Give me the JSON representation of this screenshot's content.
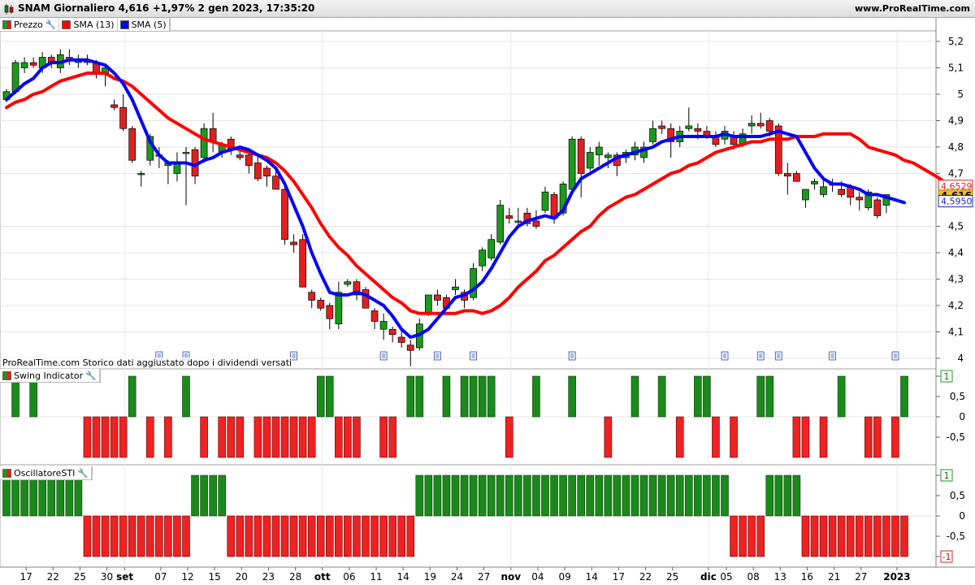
{
  "window": {
    "title": "SNAM Giornaliero 4,616 +1,97% 2 gen 2023, 17:35:20",
    "site": "www.ProRealTime.com"
  },
  "legend_main": [
    {
      "label": "Prezzo",
      "color": "#1a9a1a",
      "color2": "#e02020",
      "icon": "wrench-icon"
    },
    {
      "label": "SMA (13)",
      "color": "#ff0000"
    },
    {
      "label": "SMA (5)",
      "color": "#0000ff"
    }
  ],
  "legend_swing": {
    "label": "Swing Indicator",
    "icon": "wrench-icon"
  },
  "legend_osc": {
    "label": "OscillatoreSTI",
    "icon": "wrench-icon"
  },
  "note": "ProRealTime.com Storico dati aggiustato dopo i dividendi versati",
  "chart_data": [
    {
      "type": "candlestick",
      "title": "SNAM Giornaliero",
      "ylim": [
        3.96,
        5.24
      ],
      "yticks": [
        {
          "v": 5.2,
          "label": "5,2"
        },
        {
          "v": 5.1,
          "label": "5,1"
        },
        {
          "v": 5.0,
          "label": "5"
        },
        {
          "v": 4.9,
          "label": "4,9"
        },
        {
          "v": 4.8,
          "label": "4,8"
        },
        {
          "v": 4.7,
          "label": "4,7"
        },
        {
          "v": 4.5,
          "label": "4,5"
        },
        {
          "v": 4.4,
          "label": "4,4"
        },
        {
          "v": 4.3,
          "label": "4,3"
        },
        {
          "v": 4.2,
          "label": "4,2"
        },
        {
          "v": 4.1,
          "label": "4,1"
        },
        {
          "v": 4.0,
          "label": "4"
        }
      ],
      "price_labels": [
        {
          "v": 4.6529,
          "label": "4,6529",
          "color": "#e02020",
          "style": "outline"
        },
        {
          "v": 4.616,
          "label": "4,616",
          "color": "#f0c020",
          "style": "fill"
        },
        {
          "v": 4.595,
          "label": "4,5950",
          "color": "#2020e0",
          "style": "outline"
        }
      ],
      "candles": [
        [
          4.98,
          5.02,
          4.97,
          5.01
        ],
        [
          5.01,
          5.13,
          5.0,
          5.12
        ],
        [
          5.1,
          5.14,
          5.08,
          5.12
        ],
        [
          5.12,
          5.14,
          5.1,
          5.11
        ],
        [
          5.1,
          5.16,
          5.08,
          5.14
        ],
        [
          5.14,
          5.15,
          5.1,
          5.12
        ],
        [
          5.1,
          5.17,
          5.08,
          5.15
        ],
        [
          5.14,
          5.17,
          5.11,
          5.13
        ],
        [
          5.12,
          5.15,
          5.1,
          5.13
        ],
        [
          5.13,
          5.15,
          5.11,
          5.12
        ],
        [
          5.12,
          5.13,
          5.06,
          5.08
        ],
        [
          5.08,
          5.11,
          5.03,
          5.1
        ],
        [
          4.96,
          4.98,
          4.94,
          4.95
        ],
        [
          4.95,
          5.0,
          4.86,
          4.87
        ],
        [
          4.87,
          4.88,
          4.74,
          4.75
        ],
        [
          4.7,
          4.71,
          4.65,
          4.7
        ],
        [
          4.75,
          4.85,
          4.73,
          4.84
        ],
        [
          4.77,
          4.8,
          4.72,
          4.77
        ],
        [
          4.73,
          4.75,
          4.66,
          4.74
        ],
        [
          4.7,
          4.78,
          4.67,
          4.74
        ],
        [
          4.78,
          4.8,
          4.58,
          4.78
        ],
        [
          4.79,
          4.8,
          4.66,
          4.69
        ],
        [
          4.76,
          4.89,
          4.74,
          4.87
        ],
        [
          4.87,
          4.93,
          4.78,
          4.82
        ],
        [
          4.78,
          4.82,
          4.76,
          4.81
        ],
        [
          4.83,
          4.84,
          4.77,
          4.79
        ],
        [
          4.77,
          4.79,
          4.75,
          4.76
        ],
        [
          4.77,
          4.78,
          4.7,
          4.73
        ],
        [
          4.74,
          4.77,
          4.67,
          4.68
        ],
        [
          4.72,
          4.73,
          4.65,
          4.69
        ],
        [
          4.69,
          4.71,
          4.64,
          4.64
        ],
        [
          4.64,
          4.65,
          4.43,
          4.45
        ],
        [
          4.44,
          4.47,
          4.4,
          4.43
        ],
        [
          4.45,
          4.47,
          4.27,
          4.27
        ],
        [
          4.25,
          4.26,
          4.19,
          4.22
        ],
        [
          4.22,
          4.23,
          4.18,
          4.19
        ],
        [
          4.2,
          4.21,
          4.11,
          4.15
        ],
        [
          4.13,
          4.29,
          4.11,
          4.25
        ],
        [
          4.28,
          4.3,
          4.27,
          4.29
        ],
        [
          4.29,
          4.3,
          4.22,
          4.24
        ],
        [
          4.26,
          4.27,
          4.19,
          4.19
        ],
        [
          4.18,
          4.19,
          4.11,
          4.14
        ],
        [
          4.11,
          4.17,
          4.07,
          4.14
        ],
        [
          4.11,
          4.12,
          4.06,
          4.09
        ],
        [
          4.08,
          4.11,
          4.04,
          4.06
        ],
        [
          4.05,
          4.07,
          3.97,
          4.03
        ],
        [
          4.04,
          4.15,
          4.03,
          4.13
        ],
        [
          4.17,
          4.24,
          4.16,
          4.24
        ],
        [
          4.24,
          4.26,
          4.2,
          4.22
        ],
        [
          4.23,
          4.24,
          4.19,
          4.19
        ],
        [
          4.26,
          4.3,
          4.24,
          4.27
        ],
        [
          4.25,
          4.26,
          4.19,
          4.22
        ],
        [
          4.23,
          4.36,
          4.22,
          4.34
        ],
        [
          4.35,
          4.42,
          4.33,
          4.41
        ],
        [
          4.38,
          4.47,
          4.37,
          4.45
        ],
        [
          4.44,
          4.6,
          4.43,
          4.58
        ],
        [
          4.54,
          4.57,
          4.51,
          4.53
        ],
        [
          4.52,
          4.57,
          4.5,
          4.52
        ],
        [
          4.55,
          4.57,
          4.5,
          4.51
        ],
        [
          4.52,
          4.56,
          4.49,
          4.5
        ],
        [
          4.56,
          4.65,
          4.55,
          4.63
        ],
        [
          4.62,
          4.63,
          4.51,
          4.53
        ],
        [
          4.55,
          4.67,
          4.54,
          4.66
        ],
        [
          4.64,
          4.84,
          4.63,
          4.83
        ],
        [
          4.83,
          4.84,
          4.61,
          4.7
        ],
        [
          4.72,
          4.8,
          4.71,
          4.78
        ],
        [
          4.77,
          4.82,
          4.73,
          4.8
        ],
        [
          4.76,
          4.78,
          4.72,
          4.77
        ],
        [
          4.77,
          4.78,
          4.69,
          4.73
        ],
        [
          4.76,
          4.79,
          4.74,
          4.78
        ],
        [
          4.77,
          4.82,
          4.75,
          4.8
        ],
        [
          4.76,
          4.82,
          4.74,
          4.8
        ],
        [
          4.82,
          4.9,
          4.81,
          4.87
        ],
        [
          4.88,
          4.9,
          4.85,
          4.87
        ],
        [
          4.87,
          4.89,
          4.76,
          4.82
        ],
        [
          4.82,
          4.88,
          4.8,
          4.86
        ],
        [
          4.87,
          4.95,
          4.86,
          4.88
        ],
        [
          4.87,
          4.89,
          4.83,
          4.86
        ],
        [
          4.86,
          4.88,
          4.83,
          4.84
        ],
        [
          4.84,
          4.86,
          4.8,
          4.81
        ],
        [
          4.83,
          4.88,
          4.81,
          4.86
        ],
        [
          4.84,
          4.86,
          4.79,
          4.81
        ],
        [
          4.81,
          4.87,
          4.8,
          4.85
        ],
        [
          4.88,
          4.92,
          4.85,
          4.89
        ],
        [
          4.89,
          4.93,
          4.87,
          4.88
        ],
        [
          4.9,
          4.91,
          4.84,
          4.86
        ],
        [
          4.88,
          4.89,
          4.69,
          4.7
        ],
        [
          4.7,
          4.74,
          4.62,
          4.69
        ],
        [
          4.7,
          4.71,
          4.67,
          4.67
        ],
        [
          4.6,
          4.64,
          4.57,
          4.64
        ],
        [
          4.66,
          4.68,
          4.64,
          4.67
        ],
        [
          4.62,
          4.68,
          4.61,
          4.65
        ],
        [
          4.66,
          4.68,
          4.63,
          4.66
        ],
        [
          4.64,
          4.67,
          4.61,
          4.62
        ],
        [
          4.65,
          4.66,
          4.58,
          4.61
        ],
        [
          4.61,
          4.63,
          4.56,
          4.6
        ],
        [
          4.57,
          4.64,
          4.56,
          4.63
        ],
        [
          4.6,
          4.61,
          4.53,
          4.54
        ],
        [
          4.58,
          4.62,
          4.55,
          4.62
        ]
      ],
      "series": [
        {
          "name": "SMA (13)",
          "color": "#ff0000",
          "values": [
            4.95,
            4.97,
            4.98,
            5.0,
            5.01,
            5.03,
            5.05,
            5.06,
            5.07,
            5.08,
            5.08,
            5.08,
            5.06,
            5.05,
            5.03,
            5.0,
            4.97,
            4.94,
            4.91,
            4.89,
            4.87,
            4.85,
            4.83,
            4.82,
            4.81,
            4.8,
            4.79,
            4.78,
            4.77,
            4.76,
            4.74,
            4.71,
            4.67,
            4.62,
            4.57,
            4.51,
            4.46,
            4.42,
            4.39,
            4.35,
            4.32,
            4.29,
            4.26,
            4.23,
            4.21,
            4.18,
            4.17,
            4.17,
            4.17,
            4.17,
            4.17,
            4.18,
            4.18,
            4.17,
            4.18,
            4.2,
            4.23,
            4.27,
            4.3,
            4.33,
            4.37,
            4.39,
            4.42,
            4.45,
            4.48,
            4.5,
            4.54,
            4.57,
            4.59,
            4.61,
            4.62,
            4.64,
            4.66,
            4.68,
            4.7,
            4.71,
            4.73,
            4.74,
            4.76,
            4.78,
            4.79,
            4.8,
            4.81,
            4.82,
            4.82,
            4.83,
            4.83,
            4.83,
            4.84,
            4.84,
            4.84,
            4.85,
            4.85,
            4.85,
            4.85,
            4.83,
            4.8,
            4.79,
            4.78,
            4.77,
            4.75,
            4.74,
            4.72,
            4.7,
            4.68,
            4.65
          ]
        },
        {
          "name": "SMA (5)",
          "color": "#0000ff",
          "values": [
            4.98,
            5.01,
            5.04,
            5.06,
            5.1,
            5.12,
            5.12,
            5.13,
            5.13,
            5.13,
            5.12,
            5.11,
            5.08,
            5.04,
            4.98,
            4.9,
            4.82,
            4.77,
            4.74,
            4.74,
            4.74,
            4.73,
            4.75,
            4.76,
            4.78,
            4.79,
            4.8,
            4.79,
            4.77,
            4.75,
            4.72,
            4.66,
            4.58,
            4.5,
            4.4,
            4.32,
            4.25,
            4.24,
            4.24,
            4.25,
            4.24,
            4.22,
            4.2,
            4.16,
            4.11,
            4.08,
            4.09,
            4.11,
            4.15,
            4.19,
            4.23,
            4.24,
            4.26,
            4.29,
            4.34,
            4.4,
            4.46,
            4.5,
            4.52,
            4.53,
            4.54,
            4.53,
            4.56,
            4.63,
            4.68,
            4.7,
            4.72,
            4.74,
            4.76,
            4.77,
            4.78,
            4.79,
            4.8,
            4.82,
            4.83,
            4.84,
            4.84,
            4.84,
            4.84,
            4.84,
            4.85,
            4.84,
            4.84,
            4.84,
            4.84,
            4.85,
            4.86,
            4.85,
            4.84,
            4.78,
            4.72,
            4.68,
            4.66,
            4.66,
            4.65,
            4.64,
            4.62,
            4.62,
            4.61,
            4.6,
            4.59
          ]
        }
      ],
      "x_ticks": [
        {
          "i": 2,
          "label": "17"
        },
        {
          "i": 5,
          "label": "22"
        },
        {
          "i": 8,
          "label": "25"
        },
        {
          "i": 11,
          "label": "30"
        },
        {
          "i": 13,
          "label": "set",
          "bold": true
        },
        {
          "i": 17,
          "label": "07"
        },
        {
          "i": 20,
          "label": "12"
        },
        {
          "i": 23,
          "label": "15"
        },
        {
          "i": 26,
          "label": "20"
        },
        {
          "i": 29,
          "label": "23"
        },
        {
          "i": 32,
          "label": "28"
        },
        {
          "i": 35,
          "label": "ott",
          "bold": true
        },
        {
          "i": 38,
          "label": "06"
        },
        {
          "i": 41,
          "label": "11"
        },
        {
          "i": 44,
          "label": "14"
        },
        {
          "i": 47,
          "label": "19"
        },
        {
          "i": 50,
          "label": "24"
        },
        {
          "i": 53,
          "label": "27"
        },
        {
          "i": 56,
          "label": "nov",
          "bold": true
        },
        {
          "i": 59,
          "label": "04"
        },
        {
          "i": 62,
          "label": "09"
        },
        {
          "i": 65,
          "label": "14"
        },
        {
          "i": 68,
          "label": "17"
        },
        {
          "i": 71,
          "label": "22"
        },
        {
          "i": 74,
          "label": "25"
        },
        {
          "i": 78,
          "label": "dic",
          "bold": true
        },
        {
          "i": 80,
          "label": "05"
        },
        {
          "i": 83,
          "label": "08"
        },
        {
          "i": 86,
          "label": "13"
        },
        {
          "i": 89,
          "label": "16"
        },
        {
          "i": 92,
          "label": "21"
        },
        {
          "i": 95,
          "label": "27"
        },
        {
          "i": 99,
          "label": "2023",
          "bold": true
        }
      ],
      "event_markers": [
        17,
        20,
        32,
        42,
        48,
        52,
        63,
        80,
        84,
        86,
        92,
        99
      ]
    },
    {
      "type": "bar",
      "title": "Swing Indicator",
      "ylim": [
        -1,
        1
      ],
      "yticks": [
        {
          "v": 1,
          "label": "1"
        },
        {
          "v": 0.5,
          "label": "0,5"
        },
        {
          "v": 0,
          "label": "0"
        },
        {
          "v": -0.5,
          "label": "-0,5"
        }
      ],
      "values": [
        0,
        1,
        0,
        1,
        0,
        0,
        0,
        0,
        0,
        -1,
        -1,
        -1,
        -1,
        -1,
        1,
        0,
        -1,
        0,
        -1,
        0,
        1,
        0,
        -1,
        0,
        -1,
        -1,
        -1,
        0,
        -1,
        -1,
        -1,
        -1,
        -1,
        -1,
        -1,
        1,
        1,
        -1,
        -1,
        -1,
        0,
        0,
        -1,
        -1,
        0,
        1,
        1,
        0,
        0,
        1,
        0,
        1,
        1,
        1,
        1,
        0,
        -1,
        0,
        0,
        1,
        0,
        0,
        0,
        1,
        0,
        0,
        0,
        -1,
        0,
        0,
        1,
        0,
        0,
        1,
        0,
        -1,
        0,
        1,
        1,
        -1,
        0,
        -1,
        0,
        0,
        1,
        1,
        0,
        0,
        -1,
        -1,
        0,
        -1,
        0,
        1,
        0,
        0,
        -1,
        -1,
        0,
        -1,
        1
      ]
    },
    {
      "type": "bar",
      "title": "OscillatoreSTI",
      "ylim": [
        -1,
        1
      ],
      "yticks": [
        {
          "v": 1,
          "label": "1"
        },
        {
          "v": 0.5,
          "label": "0,5"
        },
        {
          "v": 0,
          "label": "0"
        },
        {
          "v": -0.5,
          "label": "-0,5"
        },
        {
          "v": -1,
          "label": "-1"
        }
      ],
      "values": [
        1,
        1,
        1,
        1,
        1,
        1,
        1,
        1,
        1,
        -1,
        -1,
        -1,
        -1,
        -1,
        -1,
        -1,
        -1,
        -1,
        -1,
        -1,
        -1,
        1,
        1,
        1,
        1,
        -1,
        -1,
        -1,
        -1,
        -1,
        -1,
        -1,
        -1,
        -1,
        -1,
        -1,
        -1,
        -1,
        -1,
        -1,
        -1,
        -1,
        -1,
        -1,
        -1,
        -1,
        1,
        1,
        1,
        1,
        1,
        1,
        1,
        1,
        1,
        1,
        1,
        1,
        1,
        1,
        1,
        1,
        1,
        1,
        1,
        1,
        1,
        1,
        1,
        1,
        1,
        1,
        1,
        1,
        1,
        1,
        1,
        1,
        1,
        1,
        1,
        -1,
        -1,
        -1,
        -1,
        1,
        1,
        1,
        1,
        -1,
        -1,
        -1,
        -1,
        -1,
        -1,
        -1,
        -1,
        -1,
        -1,
        -1,
        -1
      ]
    }
  ]
}
